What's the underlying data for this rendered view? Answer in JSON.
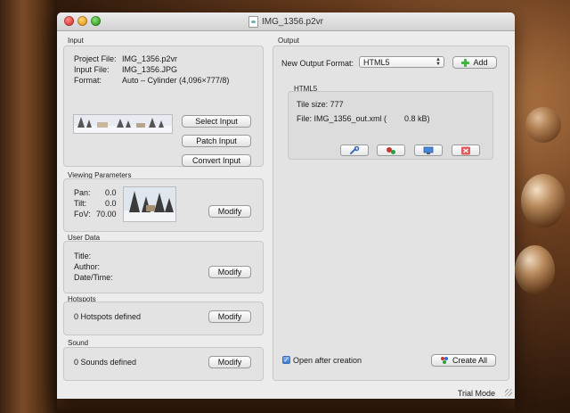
{
  "window": {
    "title": "IMG_1356.p2vr"
  },
  "input": {
    "section_label": "Input",
    "project_file_label": "Project File:",
    "project_file_value": "IMG_1356.p2vr",
    "input_file_label": "Input File:",
    "input_file_value": "IMG_1356.JPG",
    "format_label": "Format:",
    "format_value": "Auto – Cylinder (4,096×777/8)",
    "select_input_label": "Select Input",
    "patch_input_label": "Patch Input",
    "convert_input_label": "Convert Input"
  },
  "viewing": {
    "section_label": "Viewing Parameters",
    "pan_label": "Pan:",
    "pan_value": "0.0",
    "tilt_label": "Tilt:",
    "tilt_value": "0.0",
    "fov_label": "FoV:",
    "fov_value": "70.00",
    "modify_label": "Modify"
  },
  "user_data": {
    "section_label": "User Data",
    "title_label": "Title:",
    "author_label": "Author:",
    "datetime_label": "Date/Time:",
    "modify_label": "Modify"
  },
  "hotspots": {
    "section_label": "Hotspots",
    "status": "0 Hotspots defined",
    "modify_label": "Modify"
  },
  "sound": {
    "section_label": "Sound",
    "status": "0 Sounds defined",
    "modify_label": "Modify"
  },
  "output": {
    "section_label": "Output",
    "new_format_label": "New Output Format:",
    "format_selected": "HTML5",
    "add_label": "Add",
    "html5_group_label": "HTML5",
    "tile_size": "Tile size: 777",
    "file_line": "File: IMG_1356_out.xml (",
    "file_size": "0.8 kB)",
    "open_after_label": "Open after creation",
    "open_after_checked": true,
    "create_all_label": "Create All"
  },
  "status_bar": {
    "mode": "Trial Mode"
  }
}
